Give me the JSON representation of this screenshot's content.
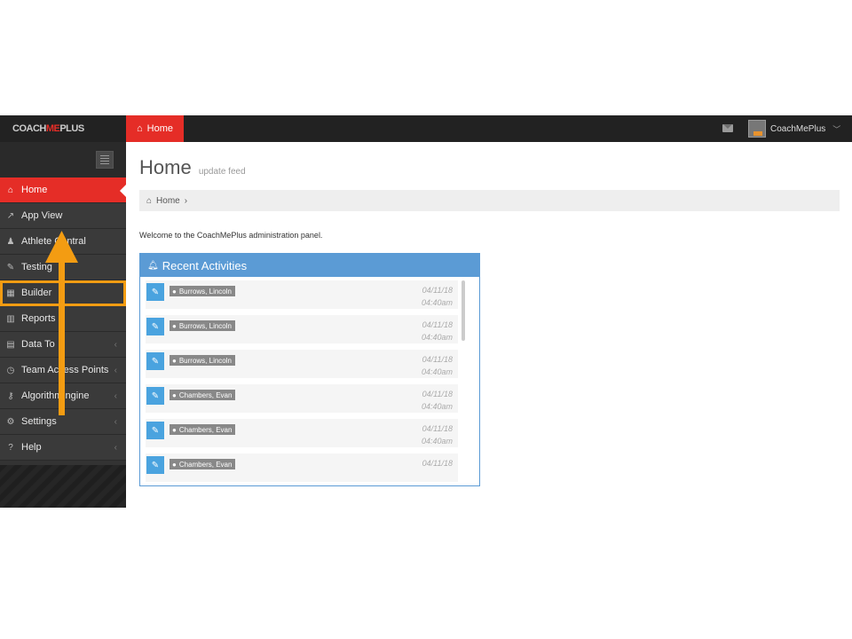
{
  "brand": {
    "prefix": "COACH",
    "mid": "ME",
    "suffix": "PLUS"
  },
  "topbar": {
    "home_tab": "Home",
    "username": "CoachMePlus"
  },
  "sidebar": {
    "items": [
      {
        "label": "Home",
        "icon": "home-icon",
        "glyph": "⌂"
      },
      {
        "label": "App View",
        "icon": "external-link-icon",
        "glyph": "↗"
      },
      {
        "label": "Athlete Central",
        "icon": "users-icon",
        "glyph": "♟"
      },
      {
        "label": "Testing",
        "icon": "edit-icon",
        "glyph": "✎"
      },
      {
        "label": "Builder",
        "icon": "calendar-icon",
        "glyph": "▦"
      },
      {
        "label": "Reports",
        "icon": "bar-chart-icon",
        "glyph": "▥"
      },
      {
        "label": "Data To",
        "icon": "table-icon",
        "glyph": "▤"
      },
      {
        "label": "Team Access Points",
        "icon": "clock-icon",
        "glyph": "◷"
      },
      {
        "label": "Algorithm ngine",
        "icon": "key-icon",
        "glyph": "⚷"
      },
      {
        "label": "Settings",
        "icon": "gears-icon",
        "glyph": "⚙"
      },
      {
        "label": "Help",
        "icon": "question-icon",
        "glyph": "?"
      }
    ]
  },
  "main": {
    "title": "Home",
    "subtitle": "update feed",
    "breadcrumb": "Home",
    "welcome": "Welcome to the CoachMePlus administration panel."
  },
  "panel": {
    "title": "Recent Activities",
    "activities": [
      {
        "name": "Burrows, Lincoln",
        "date": "04/11/18",
        "time": "04:40am"
      },
      {
        "name": "Burrows, Lincoln",
        "date": "04/11/18",
        "time": "04:40am"
      },
      {
        "name": "Burrows, Lincoln",
        "date": "04/11/18",
        "time": "04:40am"
      },
      {
        "name": "Chambers, Evan",
        "date": "04/11/18",
        "time": "04:40am"
      },
      {
        "name": "Chambers, Evan",
        "date": "04/11/18",
        "time": "04:40am"
      },
      {
        "name": "Chambers, Evan",
        "date": "04/11/18",
        "time": ""
      }
    ]
  },
  "colors": {
    "accent_red": "#e52d27",
    "panel_blue": "#5b9bd5",
    "annotation_orange": "#f39c12"
  }
}
